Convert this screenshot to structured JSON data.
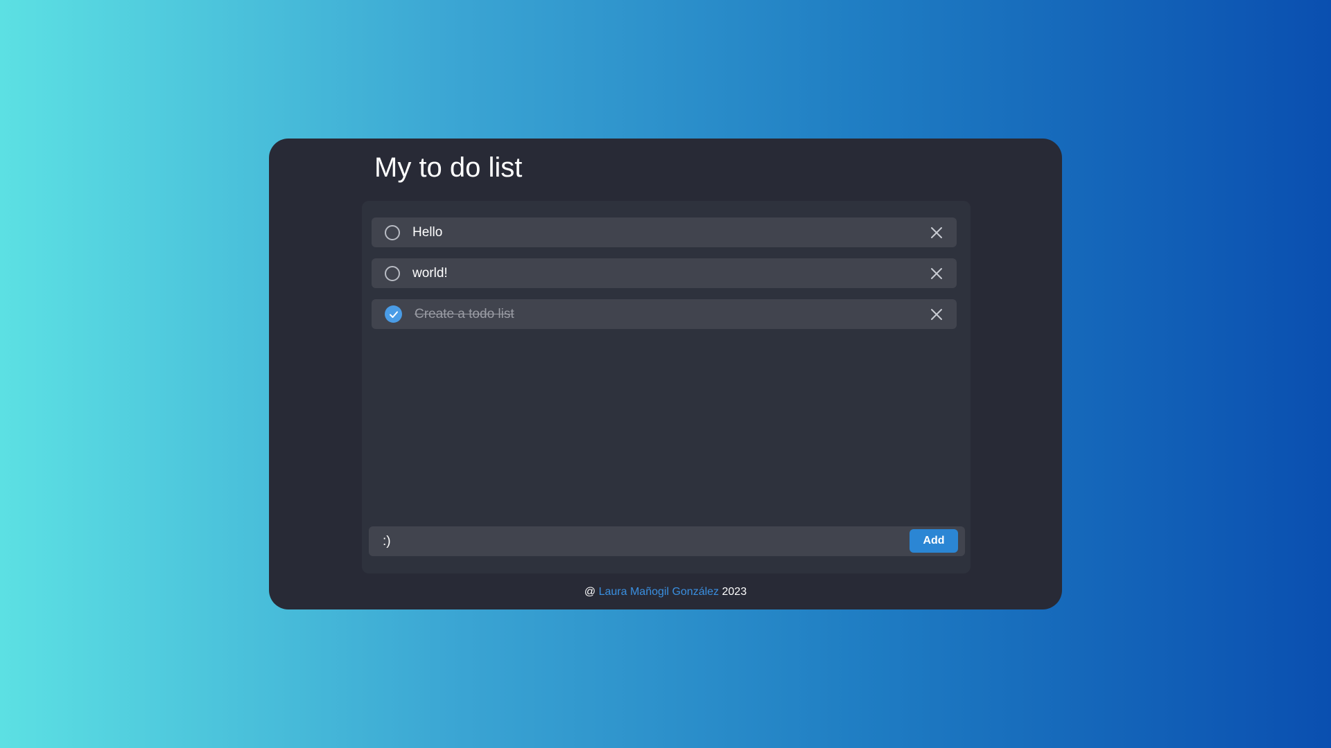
{
  "app": {
    "title": "My to do list"
  },
  "todos": [
    {
      "text": "Hello",
      "completed": false
    },
    {
      "text": "world!",
      "completed": false
    },
    {
      "text": "Create a todo list",
      "completed": true
    }
  ],
  "input": {
    "value": ":)",
    "add_label": "Add"
  },
  "footer": {
    "prefix": "@",
    "author": "Laura Mañogil González",
    "year": "2023"
  },
  "colors": {
    "card_bg": "#282a36",
    "panel_bg": "#2e323d",
    "item_bg": "#41444e",
    "accent": "#2b86d4",
    "check_done": "#4a9ce6",
    "link": "#3a8fe0"
  },
  "icons": {
    "unchecked": "circle-icon",
    "checked": "check-circle-icon",
    "delete": "close-icon"
  }
}
